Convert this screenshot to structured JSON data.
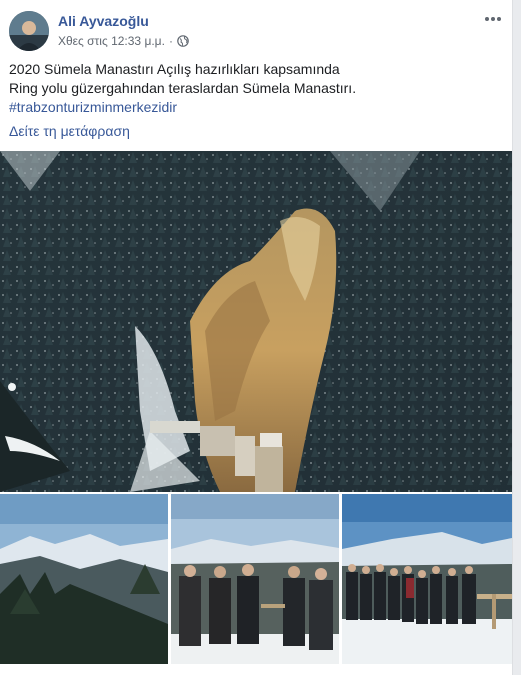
{
  "post": {
    "author_name": "Ali Ayvazoğlu",
    "timestamp": "Χθες στις 12:33 μ.μ.",
    "separator": "·",
    "privacy_icon": "globe-icon",
    "more_icon": "more-options-icon",
    "text_line1": "2020 Sümela Manastırı Açılış hazırlıkları kapsamında",
    "text_line2": "Ring yolu güzergahından teraslardan Sümela Manastırı.",
    "hashtag": "#trabzonturizminmerkezidir",
    "translate_link": "Δείτε τη μετάφραση"
  },
  "colors": {
    "link": "#385898",
    "text": "#1c1e21",
    "meta": "#606770",
    "background": "#e9ebee"
  }
}
